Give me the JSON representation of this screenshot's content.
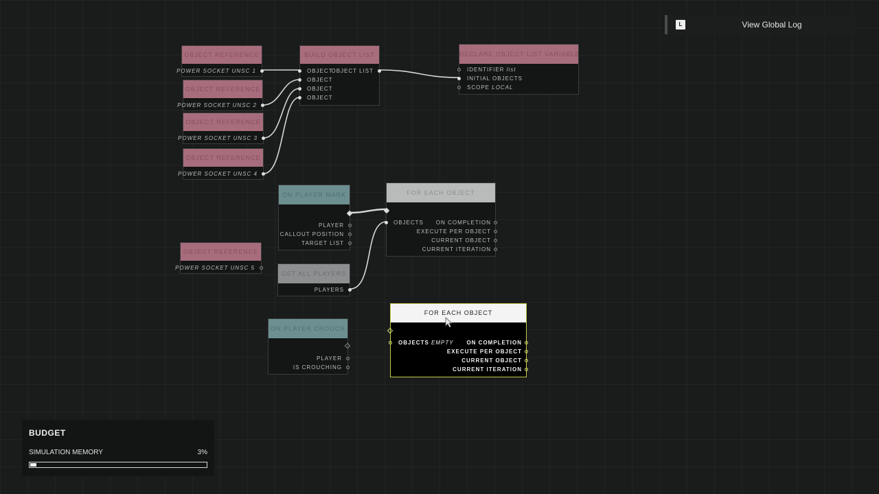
{
  "log_button": {
    "key": "L",
    "label": "View Global Log"
  },
  "budget": {
    "title": "BUDGET",
    "metric_label": "SIMULATION MEMORY",
    "metric_value": "3%",
    "fill_fraction": 0.03
  },
  "nodes": {
    "obj_ref_1": {
      "header": "OBJECT REFERENCE",
      "output": "POWER SOCKET UNSC 1"
    },
    "obj_ref_2": {
      "header": "OBJECT REFERENCE",
      "output": "POWER SOCKET UNSC 2"
    },
    "obj_ref_3": {
      "header": "OBJECT REFERENCE",
      "output": "POWER SOCKET UNSC 3"
    },
    "obj_ref_4": {
      "header": "OBJECT REFERENCE",
      "output": "POWER SOCKET UNSC 4"
    },
    "obj_ref_5": {
      "header": "OBJECT REFERENCE",
      "output": "POWER SOCKET UNSC 5"
    },
    "list_builder": {
      "header": "BUILD OBJECT LIST",
      "inputs": [
        "OBJECT",
        "OBJECT",
        "OBJECT",
        "OBJECT"
      ],
      "output": "OBJECT LIST"
    },
    "declare_var": {
      "header": "DECLARE OBJECT LIST VARIABLE",
      "id_label": "IDENTIFIER",
      "id_value": "list",
      "initial": "INITIAL OBJECTS",
      "scope_label": "SCOPE",
      "scope_value": "LOCAL"
    },
    "player_mark": {
      "header": "ON PLAYER MARK",
      "outputs": [
        "PLAYER",
        "CALLOUT POSITION",
        "TARGET LIST"
      ]
    },
    "foreach_a": {
      "header": "FOR EACH OBJECT",
      "input": "OBJECTS",
      "outputs": [
        "ON COMPLETION",
        "EXECUTE PER OBJECT",
        "CURRENT OBJECT",
        "CURRENT ITERATION"
      ]
    },
    "get_players": {
      "header": "GET ALL PLAYERS",
      "output": "PLAYERS"
    },
    "crouch": {
      "header": "ON PLAYER CROUCH",
      "outputs": [
        "PLAYER",
        "IS CROUCHING"
      ]
    },
    "foreach_sel": {
      "header": "FOR EACH OBJECT",
      "input_label": "OBJECTS",
      "input_value": "EMPTY",
      "outputs": [
        "ON COMPLETION",
        "EXECUTE PER OBJECT",
        "CURRENT OBJECT",
        "CURRENT ITERATION"
      ]
    }
  }
}
